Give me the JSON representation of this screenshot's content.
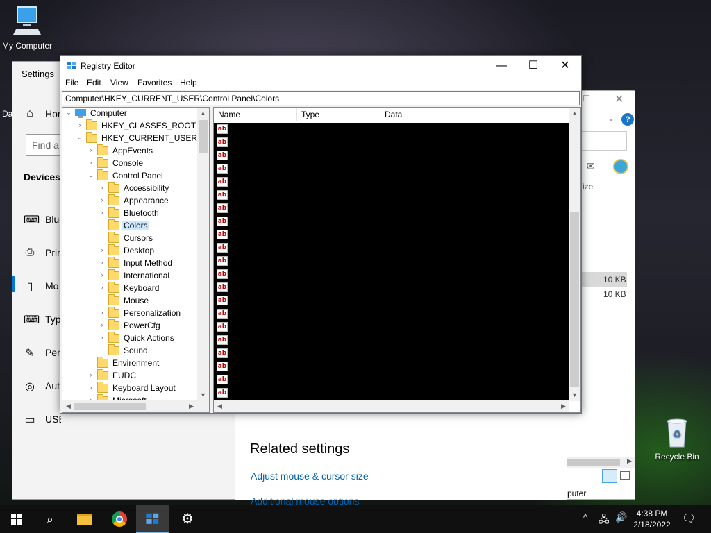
{
  "desktop": {
    "icons": [
      {
        "label": "My Computer",
        "icon": "computer-icon"
      },
      {
        "label": "Recycle Bin",
        "icon": "recycle-bin-icon"
      }
    ]
  },
  "settings": {
    "title": "Settings",
    "home_label": "Hon",
    "search_placeholder": "Find a",
    "section": "Devices",
    "nav": [
      {
        "label": "Blue",
        "icon": "bluetooth-icon"
      },
      {
        "label": "Prin",
        "icon": "printer-icon"
      },
      {
        "label": "Mo",
        "icon": "mouse-icon"
      },
      {
        "label": "Typ",
        "icon": "keyboard-icon"
      },
      {
        "label": "Pen",
        "icon": "pen-icon"
      },
      {
        "label": "Aut",
        "icon": "autoplay-icon"
      },
      {
        "label": "USB",
        "icon": "usb-icon"
      }
    ],
    "side_fragment": "Da",
    "related_title": "Related settings",
    "links": [
      "Adjust mouse & cursor size",
      "Additional mouse options"
    ]
  },
  "explorer": {
    "size_header": "ize",
    "sizes": [
      "10 KB",
      "10 KB"
    ],
    "status": "puter"
  },
  "registry": {
    "title": "Registry Editor",
    "menu": [
      "File",
      "Edit",
      "View",
      "Favorites",
      "Help"
    ],
    "address": "Computer\\HKEY_CURRENT_USER\\Control Panel\\Colors",
    "columns": [
      "Name",
      "Type",
      "Data"
    ],
    "tree": {
      "root": "Computer",
      "hives": [
        "HKEY_CLASSES_ROOT",
        "HKEY_CURRENT_USER"
      ],
      "hkcu_children_top": [
        "AppEvents",
        "Console",
        "Control Panel"
      ],
      "control_panel_children": [
        "Accessibility",
        "Appearance",
        "Bluetooth",
        "Colors",
        "Cursors",
        "Desktop",
        "Input Method",
        "International",
        "Keyboard",
        "Mouse",
        "Personalization",
        "PowerCfg",
        "Quick Actions",
        "Sound"
      ],
      "hkcu_children_bottom": [
        "Environment",
        "EUDC",
        "Keyboard Layout",
        "Microsoft"
      ],
      "selected": "Colors"
    },
    "value_icon_text": "ab",
    "value_rows": 21
  },
  "taskbar": {
    "time": "4:38 PM",
    "date": "2/18/2022"
  }
}
